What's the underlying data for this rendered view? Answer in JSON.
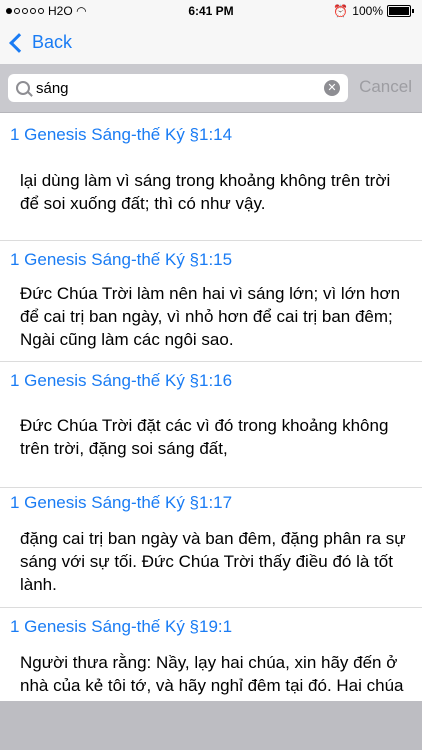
{
  "status_bar": {
    "carrier": "H2O",
    "time": "6:41 PM",
    "battery": "100%"
  },
  "nav": {
    "back_label": "Back"
  },
  "search": {
    "query": "sáng",
    "cancel_label": "Cancel"
  },
  "results": [
    {
      "reference": "1 Genesis Sáng-thế Ký §1:14",
      "text": "lại dùng làm vì sáng trong khoảng không trên trời để soi xuống đất; thì có như vậy."
    },
    {
      "reference": "1 Genesis Sáng-thế Ký §1:15",
      "text": "Đức Chúa Trời làm nên hai vì sáng lớn; vì lớn hơn để cai trị ban ngày, vì nhỏ hơn để cai trị ban đêm; Ngài cũng làm các ngôi sao."
    },
    {
      "reference": "1 Genesis Sáng-thế Ký §1:16",
      "text": "Đức Chúa Trời đặt các vì đó trong khoảng không trên trời, đặng soi sáng đất,"
    },
    {
      "reference": "1 Genesis Sáng-thế Ký §1:17",
      "text": "đặng cai trị ban ngày và ban đêm, đặng phân ra sự sáng với sự tối. Đức Chúa Trời thấy điều đó là tốt lành."
    },
    {
      "reference": "1 Genesis Sáng-thế Ký §19:1",
      "text": "Người thưa rằng: Nầy, lạy hai chúa, xin hãy đến ở nhà của kẻ tôi tớ, và hãy nghỉ đêm tại đó. Hai chúa hãy rửa chơn, rồi sáng mai thức"
    }
  ]
}
